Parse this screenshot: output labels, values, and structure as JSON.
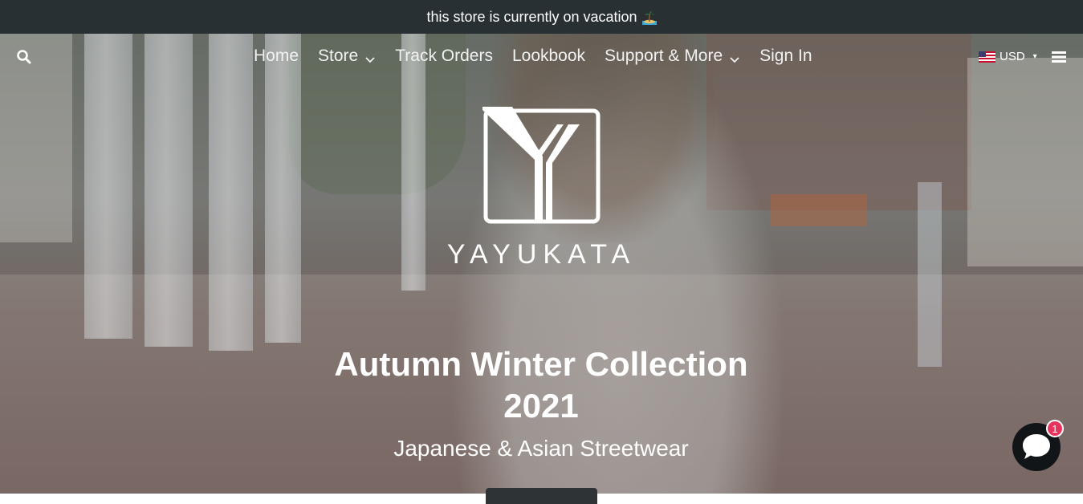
{
  "announcement": {
    "text": "this store is currently on vacation",
    "icon": "island-icon"
  },
  "nav": {
    "search_icon": "search-icon",
    "items": [
      {
        "label": "Home",
        "has_dropdown": false
      },
      {
        "label": "Store",
        "has_dropdown": true
      },
      {
        "label": "Track Orders",
        "has_dropdown": false
      },
      {
        "label": "Lookbook",
        "has_dropdown": false
      },
      {
        "label": "Support & More",
        "has_dropdown": true
      },
      {
        "label": "Sign In",
        "has_dropdown": false
      }
    ],
    "currency": {
      "label": "USD",
      "flag": "us-flag-icon"
    },
    "menu_icon": "hamburger-menu-icon"
  },
  "hero": {
    "brand": "YAYUKATA",
    "headline": "Autumn Winter Collection 2021",
    "subheadline": "Japanese & Asian Streetwear"
  },
  "chat": {
    "badge_count": "1",
    "icon": "chat-bubble-icon"
  },
  "colors": {
    "announcement_bg": "#283034",
    "text": "#ffffff",
    "badge": "#e8335c",
    "chat_bg": "#111518"
  }
}
